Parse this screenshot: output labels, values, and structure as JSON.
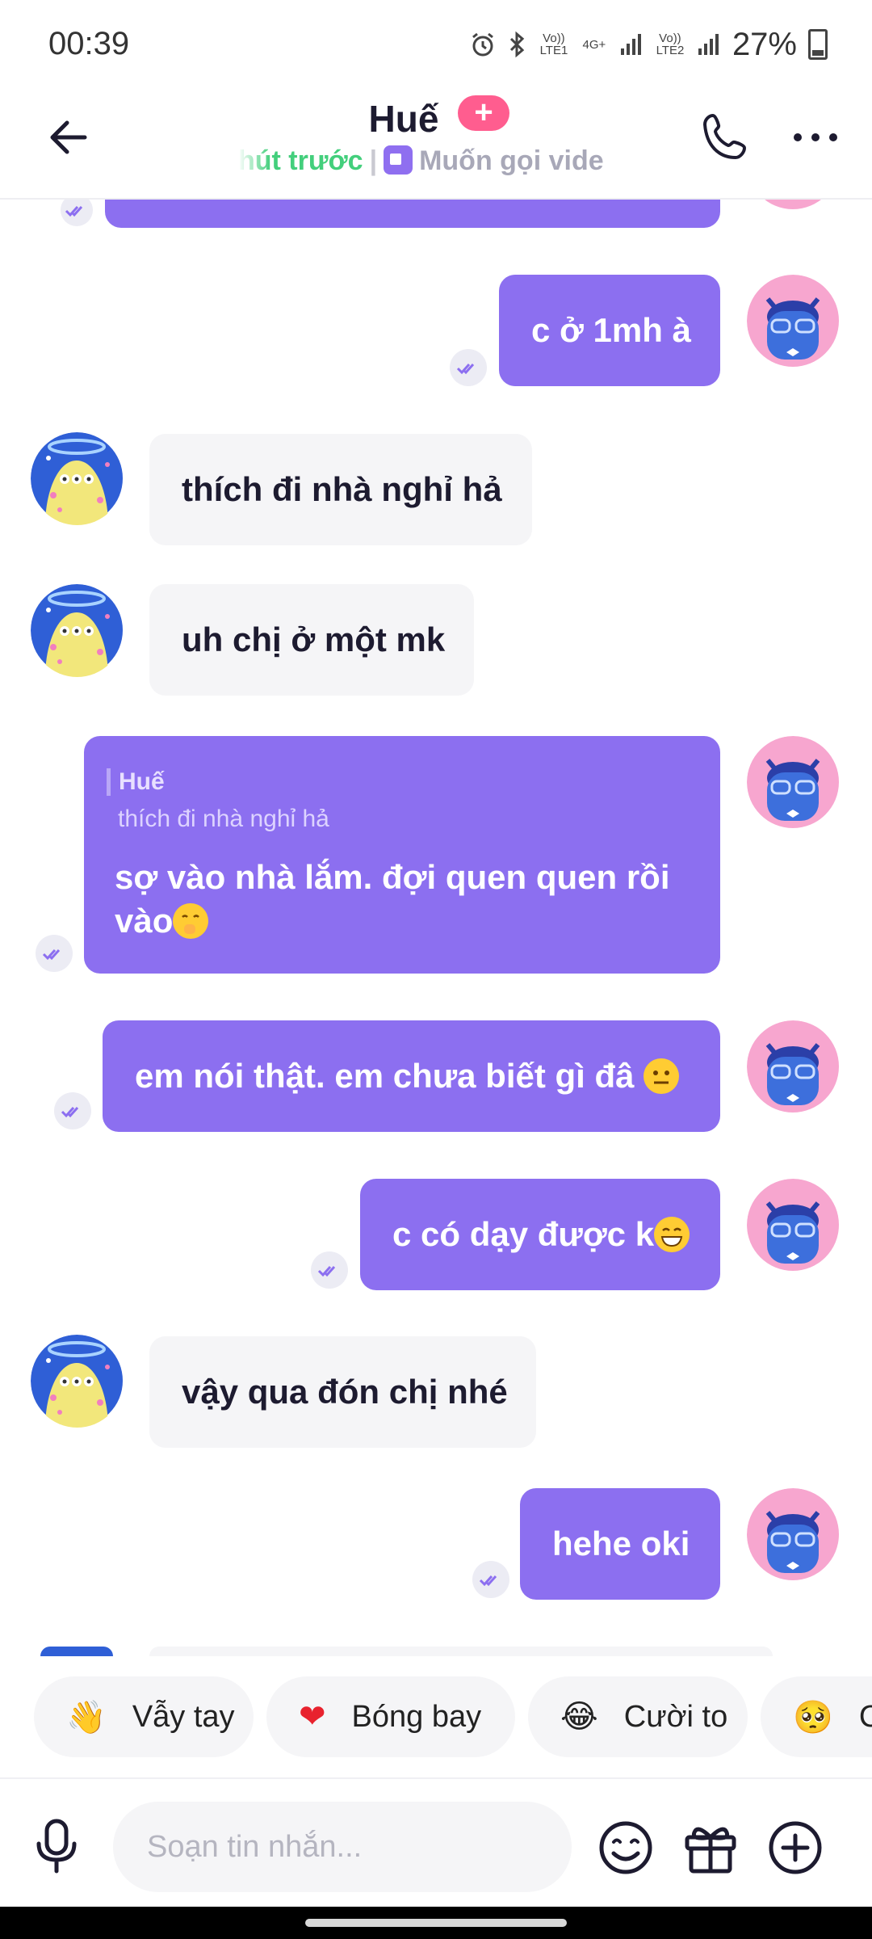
{
  "status_bar": {
    "time": "00:39",
    "sim1_label": "Vo)) LTE1",
    "net_label": "4G+",
    "sim2_label": "Vo)) LTE2",
    "battery": "27%"
  },
  "header": {
    "contact_name": "Huế",
    "add_badge": "+",
    "online_status": "hút trước",
    "separator": "|",
    "video_prompt": "Muốn gọi vide"
  },
  "messages": [
    {
      "id": "m0",
      "direction": "out",
      "text": ""
    },
    {
      "id": "m1",
      "direction": "out",
      "text": "c ở 1mh à"
    },
    {
      "id": "m2",
      "direction": "in",
      "text": "thích đi nhà nghỉ hả"
    },
    {
      "id": "m3",
      "direction": "in",
      "text": "uh chị ở một mk"
    },
    {
      "id": "m4",
      "direction": "out",
      "quote_name": "Huế",
      "quote_text": "thích đi nhà nghỉ hả",
      "line1": "sợ vào nhà lắm. đợi quen quen rồi",
      "line2": "vào"
    },
    {
      "id": "m5",
      "direction": "out",
      "text": "em nói thật. em chưa biết gì đâ"
    },
    {
      "id": "m6",
      "direction": "out",
      "text": "c có dạy được k"
    },
    {
      "id": "m7",
      "direction": "in",
      "text": "vậy qua đón chị nhé"
    },
    {
      "id": "m8",
      "direction": "out",
      "text": "hehe oki"
    }
  ],
  "reactions": [
    {
      "icon": "👋",
      "label": "Vẫy tay"
    },
    {
      "icon": "❤",
      "label": "Bóng bay"
    },
    {
      "icon": "😂",
      "label": "Cười to"
    },
    {
      "icon": "🥺",
      "label": "C"
    }
  ],
  "composer": {
    "placeholder": "Soạn tin nhắn..."
  },
  "colors": {
    "accent": "#8c6ff0",
    "online": "#43cf7c",
    "badge": "#ff5d8f"
  }
}
